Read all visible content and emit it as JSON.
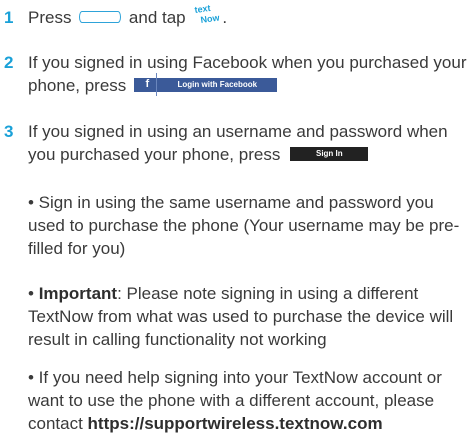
{
  "step1": {
    "number": "1",
    "before": "Press ",
    "middle": " and tap ",
    "logo_text_top": "text",
    "logo_text_bottom": "Now",
    "end": "."
  },
  "step2": {
    "number": "2",
    "text": "If you signed in using Facebook when you purchased your phone, press",
    "fb_icon": "f",
    "fb_label": "Login with Facebook"
  },
  "step3": {
    "number": "3",
    "text": "If you signed in using an username and password when you purchased your phone, press",
    "signin_label": "Sign In"
  },
  "bullets": {
    "b1": "• Sign in using the same username and password you used to purchase the phone (Your username may be pre-filled for you)",
    "b2_prefix": "• ",
    "b2_bold": "Important",
    "b2_rest": ": Please note signing in using a different TextNow from what was used to purchase the device will result in calling functionality not working",
    "b3_text": "• If you need help signing into your TextNow account or want to use the phone with a different account, please contact ",
    "b3_link": "https://supportwireless.textnow.com"
  },
  "colors": {
    "accent": "#1aa1d8",
    "facebook": "#3b5a99",
    "signin": "#222222"
  }
}
